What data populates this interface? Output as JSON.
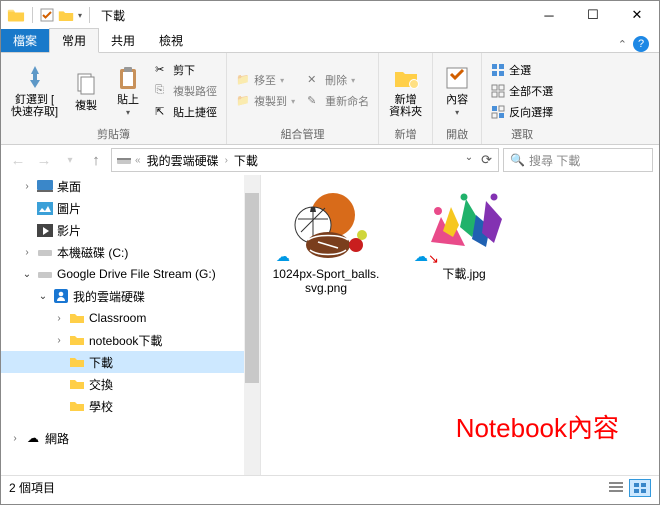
{
  "window": {
    "title": "下載"
  },
  "tabs": {
    "file": "檔案",
    "home": "常用",
    "share": "共用",
    "view": "檢視"
  },
  "ribbon": {
    "pin": "釘選到 [\n快速存取]",
    "copy": "複製",
    "paste": "貼上",
    "cut": "剪下",
    "copypath": "複製路徑",
    "pasteshortcut": "貼上捷徑",
    "clipboard_group": "剪貼簿",
    "moveto": "移至",
    "copyto": "複製到",
    "delete": "刪除",
    "rename": "重新命名",
    "organize_group": "組合管理",
    "newfolder": "新增\n資料夾",
    "new_group": "新增",
    "content": "內容",
    "open_group": "開啟",
    "selectall": "全選",
    "selectnone": "全部不選",
    "invert": "反向選擇",
    "select_group": "選取"
  },
  "breadcrumb": {
    "b1": "我的雲端硬碟",
    "b2": "下載"
  },
  "search": {
    "placeholder": "搜尋 下載"
  },
  "tree": {
    "desktop": "桌面",
    "pictures": "圖片",
    "videos": "影片",
    "localc": "本機磁碟 (C:)",
    "gdrive": "Google Drive File Stream (G:)",
    "mydrive": "我的雲端硬碟",
    "classroom": "Classroom",
    "nbdl": "notebook下載",
    "download": "下載",
    "exchange": "交換",
    "school": "學校",
    "network": "網路"
  },
  "files": [
    {
      "name": "1024px-Sport_balls.svg.png"
    },
    {
      "name": "下載.jpg"
    }
  ],
  "status": {
    "count": "2 個項目"
  },
  "annotation": "Notebook內容"
}
